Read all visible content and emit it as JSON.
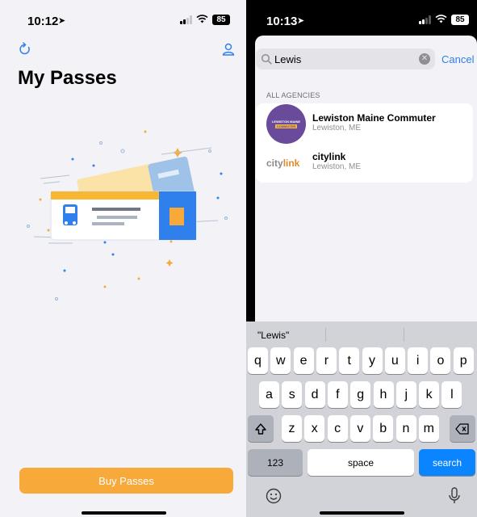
{
  "left_screen": {
    "status_bar": {
      "time": "10:12",
      "battery": "85"
    },
    "title": "My Passes",
    "buy_button_label": "Buy Passes",
    "colors": {
      "accent": "#2f80ed",
      "buy_button": "#f7a93a"
    }
  },
  "right_screen": {
    "status_bar": {
      "time": "10:13",
      "battery": "85"
    },
    "search": {
      "value": "Lewis",
      "cancel_label": "Cancel"
    },
    "section_label": "ALL AGENCIES",
    "results": [
      {
        "logo_line1": "LEWISTON MAINE",
        "logo_line2": "COMMUTER",
        "title": "Lewiston Maine Commuter",
        "subtitle": "Lewiston, ME"
      },
      {
        "logo_city": "city",
        "logo_link": "link",
        "title": "citylink",
        "subtitle": "Lewiston, ME"
      }
    ],
    "keyboard": {
      "suggestion": "\"Lewis\"",
      "row1": [
        "q",
        "w",
        "e",
        "r",
        "t",
        "y",
        "u",
        "i",
        "o",
        "p"
      ],
      "row2": [
        "a",
        "s",
        "d",
        "f",
        "g",
        "h",
        "j",
        "k",
        "l"
      ],
      "row3": [
        "z",
        "x",
        "c",
        "v",
        "b",
        "n",
        "m"
      ],
      "numbers_key": "123",
      "space_key": "space",
      "search_key": "search"
    }
  }
}
